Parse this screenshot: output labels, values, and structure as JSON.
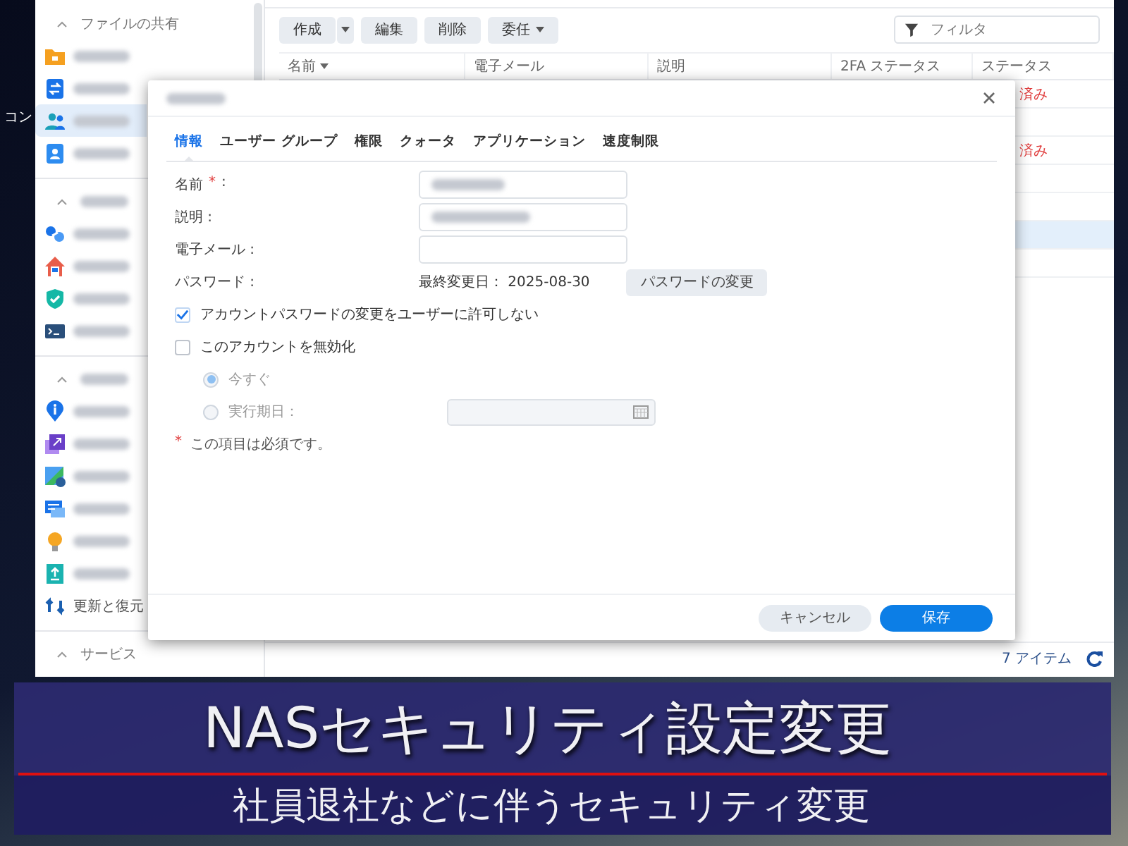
{
  "desktop": {
    "label": "コン"
  },
  "sidebar": {
    "sections": [
      {
        "title": "ファイルの共有",
        "expanded": true,
        "items": [
          {
            "selected": false
          },
          {
            "selected": false
          },
          {
            "selected": true
          },
          {
            "selected": false
          }
        ]
      },
      {
        "expanded": true,
        "items": [
          {
            "selected": false
          },
          {
            "selected": false
          },
          {
            "selected": false
          },
          {
            "selected": false
          }
        ]
      },
      {
        "expanded": true,
        "items": [
          {
            "selected": false
          },
          {
            "selected": false
          },
          {
            "selected": false
          },
          {
            "selected": false
          },
          {
            "selected": false
          },
          {
            "selected": false
          },
          {
            "label": "更新と復元",
            "selected": false
          }
        ]
      },
      {
        "title": "サービス",
        "expanded": true
      }
    ]
  },
  "toolbar": {
    "buttons": [
      {
        "label": "作成",
        "kind": "split"
      },
      {
        "label": "編集",
        "kind": "plain"
      },
      {
        "label": "削除",
        "kind": "plain"
      },
      {
        "label": "委任",
        "kind": "menu"
      }
    ],
    "filter": {
      "placeholder": "フィルタ"
    }
  },
  "table": {
    "columns": [
      {
        "label": "名前",
        "sorted": true
      },
      {
        "label": "電子メール",
        "sorted": false
      },
      {
        "label": "説明",
        "sorted": false
      },
      {
        "label": "2FA ステータス",
        "sorted": false
      },
      {
        "label": "ステータス",
        "sorted": false
      }
    ],
    "rows": [
      {
        "status": "済み",
        "selected": false
      },
      {
        "selected": false
      },
      {
        "status": "済み",
        "selected": false
      },
      {
        "selected": false
      },
      {
        "selected": false
      },
      {
        "selected": true
      },
      {
        "selected": false
      }
    ]
  },
  "footer": {
    "count": "7 アイテム"
  },
  "dialog": {
    "tabs": [
      {
        "label": "情報",
        "selected": true
      },
      {
        "label": "ユーザー グループ",
        "selected": false
      },
      {
        "label": "権限",
        "selected": false
      },
      {
        "label": "クォータ",
        "selected": false
      },
      {
        "label": "アプリケーション",
        "selected": false
      },
      {
        "label": "速度制限",
        "selected": false
      }
    ],
    "fields": [
      {
        "kind": "text",
        "label": "名前",
        "required_mark": "*",
        "label_suffix": ":",
        "blurred": true
      },
      {
        "kind": "text",
        "label": "説明 :",
        "blurred": true
      },
      {
        "kind": "text",
        "label": "電子メール :",
        "blurred": false
      },
      {
        "kind": "password",
        "label": "パスワード :",
        "info": "最終変更日： 2025-08-30",
        "button": "パスワードの変更"
      }
    ],
    "checkboxes": [
      {
        "label": "アカウントパスワードの変更をユーザーに許可しない",
        "checked": true
      },
      {
        "label": "このアカウントを無効化",
        "checked": false
      }
    ],
    "radios": [
      {
        "label": "今すぐ",
        "selected": true,
        "disabled": true
      },
      {
        "label": "実行期日：",
        "selected": false,
        "disabled": true
      }
    ],
    "date_field": {
      "disabled": true
    },
    "note": {
      "mark": "*",
      "text": "この項目は必須です。"
    },
    "buttons": [
      {
        "label": "キャンセル",
        "kind": "secondary"
      },
      {
        "label": "保存",
        "kind": "primary"
      }
    ]
  },
  "banner": {
    "title": "NASセキュリティ設定変更",
    "subtitle": "社員退社などに伴うセキュリティ変更"
  }
}
